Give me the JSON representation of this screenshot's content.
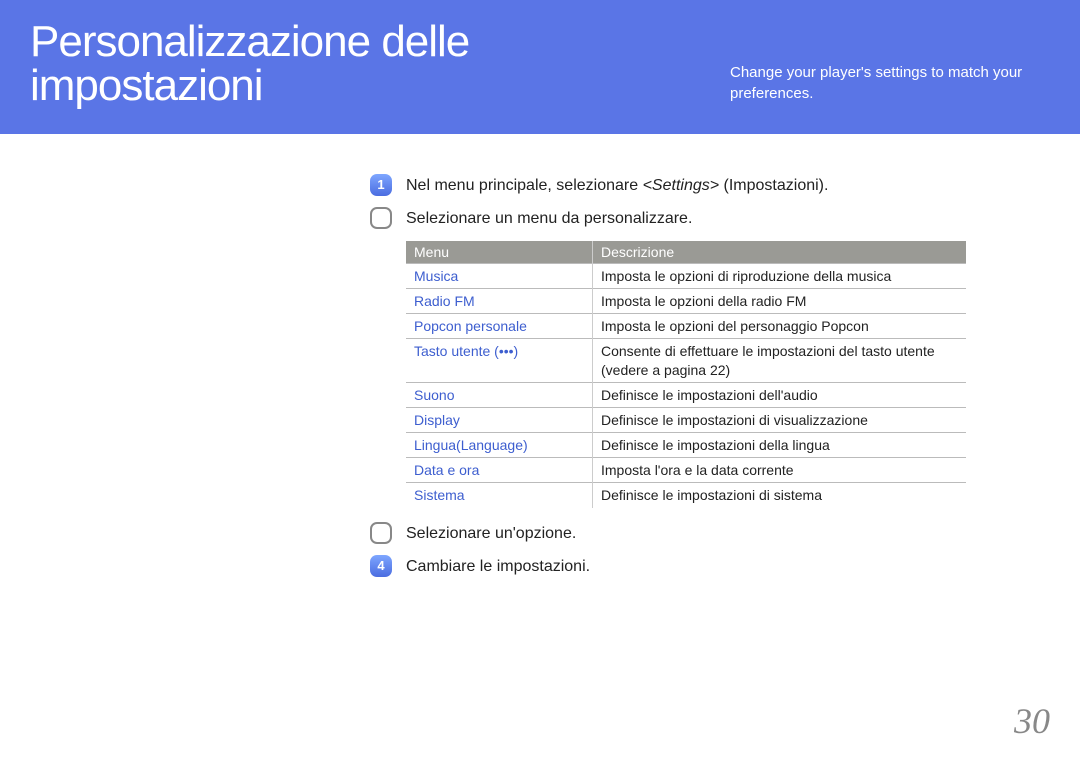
{
  "header": {
    "title": "Personalizzazione delle impostazioni",
    "subtitle": "Change your player's settings to match your preferences."
  },
  "steps": [
    {
      "number": "1",
      "style": "filled",
      "text_pre": "Nel menu principale, selezionare ",
      "text_em": "<Settings>",
      "text_post": " (Impostazioni)."
    },
    {
      "number": "",
      "style": "outline",
      "text_pre": "Selezionare un menu da personalizzare.",
      "text_em": "",
      "text_post": ""
    },
    {
      "number": "",
      "style": "outline",
      "text_pre": "Selezionare un'opzione.",
      "text_em": "",
      "text_post": ""
    },
    {
      "number": "4",
      "style": "filled",
      "text_pre": "Cambiare le impostazioni.",
      "text_em": "",
      "text_post": ""
    }
  ],
  "table": {
    "header_menu": "Menu",
    "header_desc": "Descrizione",
    "rows": [
      {
        "menu": "Musica",
        "desc": "Imposta le opzioni di riproduzione della musica"
      },
      {
        "menu": "Radio FM",
        "desc": "Imposta le opzioni della radio FM"
      },
      {
        "menu": "Popcon personale",
        "desc": "Imposta le opzioni del personaggio Popcon"
      },
      {
        "menu": "Tasto utente (•••)",
        "desc": "Consente di effettuare le impostazioni del tasto utente (vedere a pagina 22)"
      },
      {
        "menu": "Suono",
        "desc": "Definisce le impostazioni dell'audio"
      },
      {
        "menu": "Display",
        "desc": "Definisce le impostazioni di visualizzazione"
      },
      {
        "menu": "Lingua(Language)",
        "desc": "Definisce le impostazioni della lingua"
      },
      {
        "menu": "Data e ora",
        "desc": "Imposta l'ora e la data corrente"
      },
      {
        "menu": "Sistema",
        "desc": "Definisce le impostazioni di sistema"
      }
    ]
  },
  "page_number": "30"
}
